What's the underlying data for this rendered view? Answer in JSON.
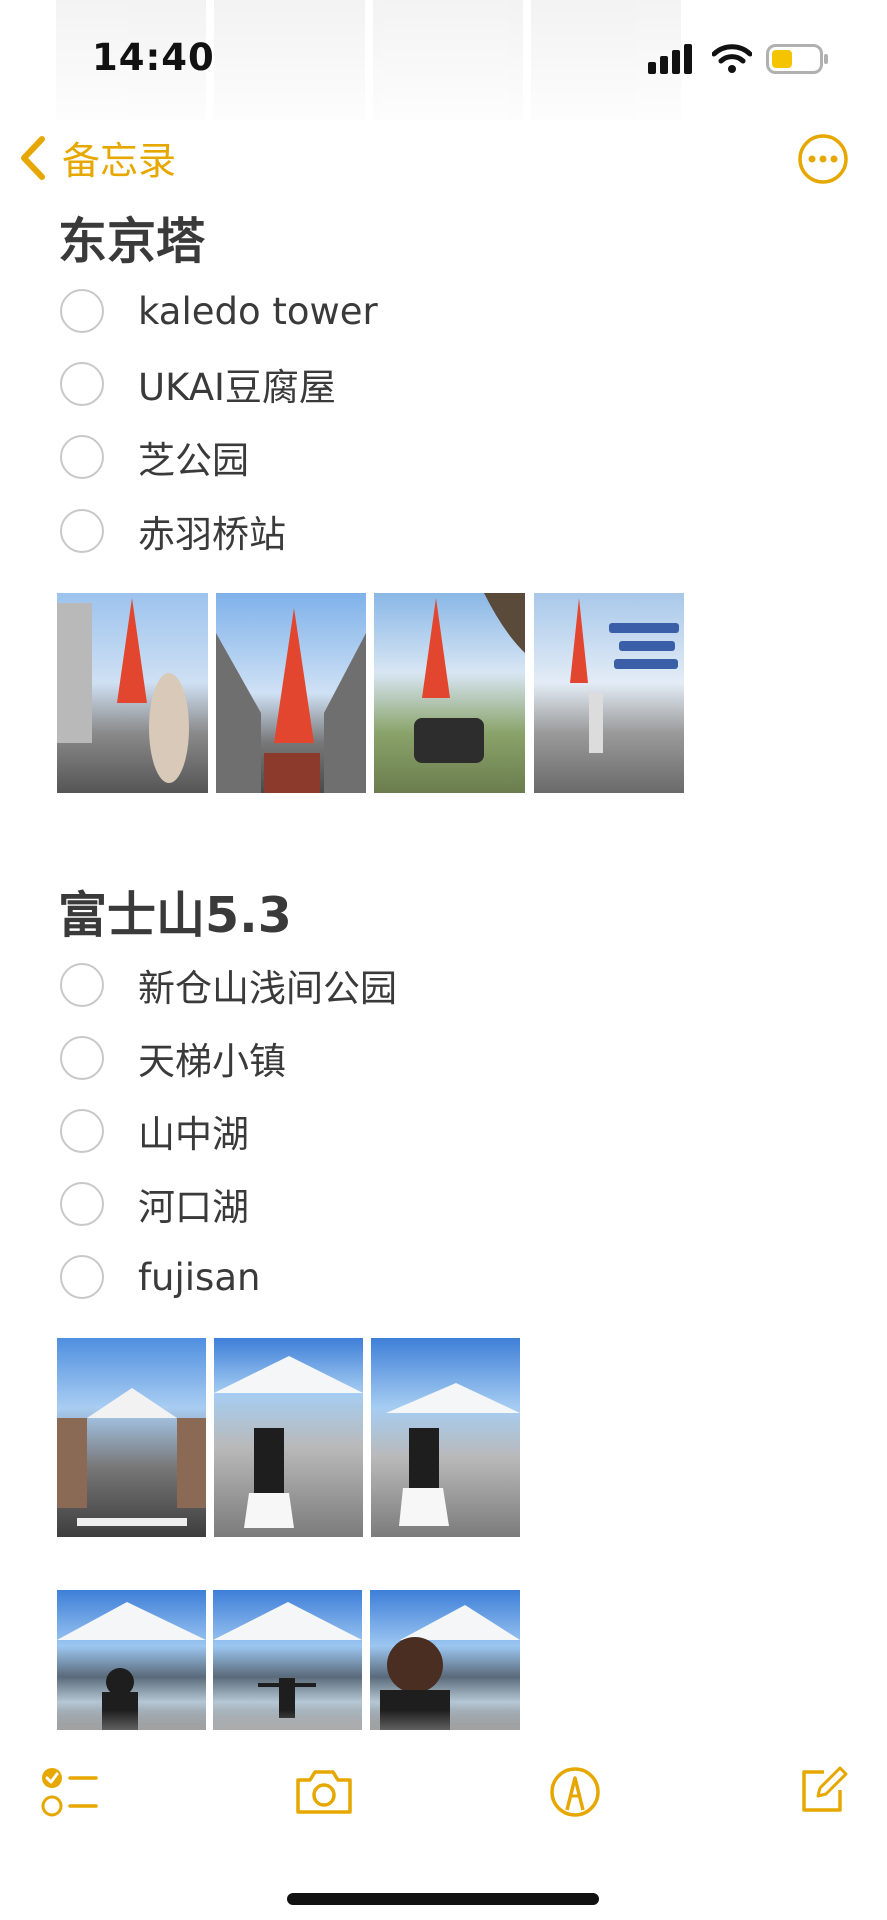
{
  "status": {
    "time": "14:40"
  },
  "nav": {
    "back_label": "备忘录"
  },
  "sections": [
    {
      "title": "东京塔",
      "items": [
        "kaledo tower",
        "UKAI豆腐屋",
        "芝公园",
        "赤羽桥站"
      ]
    },
    {
      "title": "富士山5.3",
      "items": [
        "新仓山浅间公园",
        "天梯小镇",
        "山中湖",
        "河口湖",
        "fujisan"
      ]
    }
  ],
  "colors": {
    "accent": "#e6a800",
    "checkbox": "#c8c8c8",
    "text": "#3a3a3a"
  },
  "toolbar": {
    "icons": [
      "checklist-icon",
      "camera-icon",
      "markup-icon",
      "compose-icon"
    ]
  }
}
